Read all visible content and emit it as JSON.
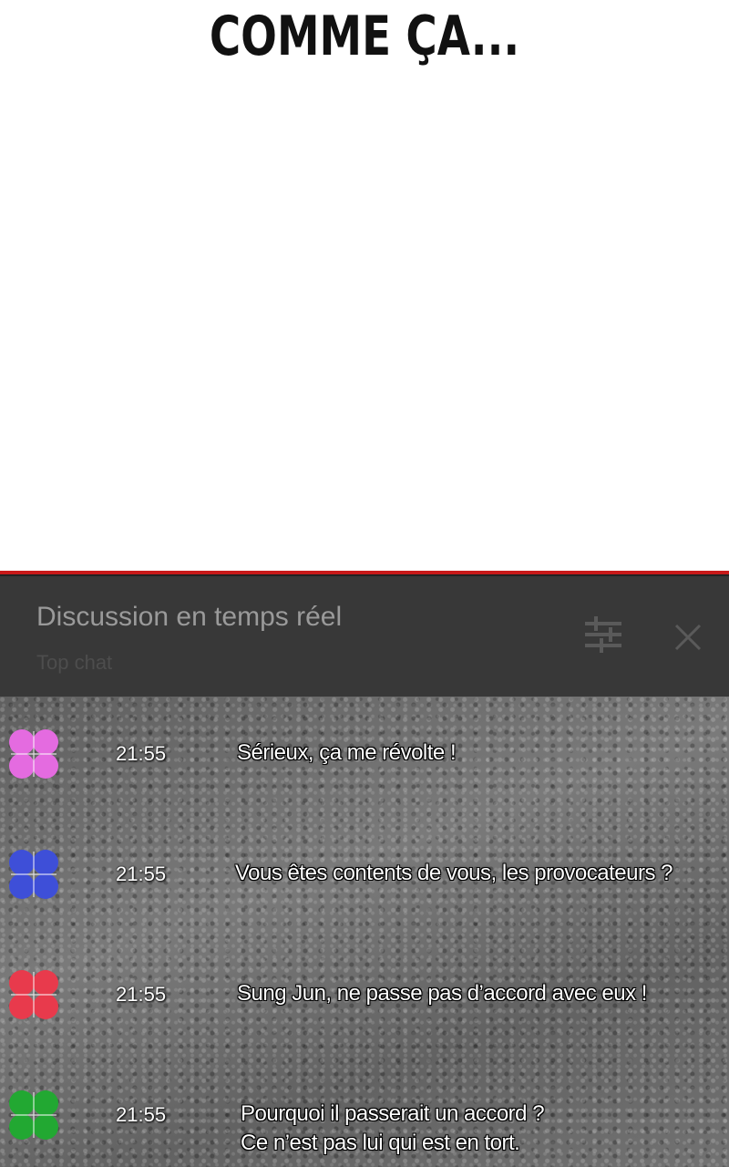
{
  "title": "COMME ÇA...",
  "chat": {
    "header_title": "Discussion en temps réel",
    "header_subtitle": "Top chat",
    "accent_color": "#c81a1a",
    "messages": [
      {
        "avatar_icon": "clover-avatar-icon",
        "avatar_color": "#e46be0",
        "time": "21:55",
        "text": "Sérieux, ça me révolte !",
        "line2": ""
      },
      {
        "avatar_icon": "clover-avatar-icon",
        "avatar_color": "#3e4fd8",
        "time": "21:55",
        "text": "Vous êtes contents de vous, les provocateurs ?",
        "line2": ""
      },
      {
        "avatar_icon": "clover-avatar-icon",
        "avatar_color": "#e83a4c",
        "time": "21:55",
        "text": "Sung Jun, ne passe pas d’accord avec eux !",
        "line2": ""
      },
      {
        "avatar_icon": "clover-avatar-icon",
        "avatar_color": "#22a832",
        "time": "21:55",
        "text": "Pourquoi il passerait un accord ?",
        "line2": "Ce n’est pas lui qui est en tort."
      }
    ]
  }
}
